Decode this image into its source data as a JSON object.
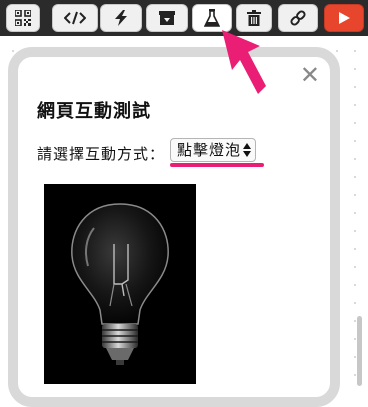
{
  "toolbar": {
    "buttons": [
      {
        "icon": "qr-code-icon"
      },
      {
        "icon": "code-icon"
      },
      {
        "icon": "lightning-icon"
      },
      {
        "icon": "download-box-icon"
      },
      {
        "icon": "flask-icon",
        "active": true
      },
      {
        "icon": "trash-icon"
      },
      {
        "icon": "link-icon"
      },
      {
        "icon": "play-icon"
      }
    ],
    "colors": {
      "bar": "#2b2b2b",
      "play": "#e8452d"
    }
  },
  "card": {
    "close_label": "✕",
    "title": "網頁互動測試",
    "prompt": "請選擇互動方式：",
    "select_value": "點擊燈泡",
    "image_icon": "light-bulb-image"
  },
  "annotation": {
    "color": "#ea1e74",
    "marks": [
      "pointer-arrow",
      "underline"
    ]
  }
}
